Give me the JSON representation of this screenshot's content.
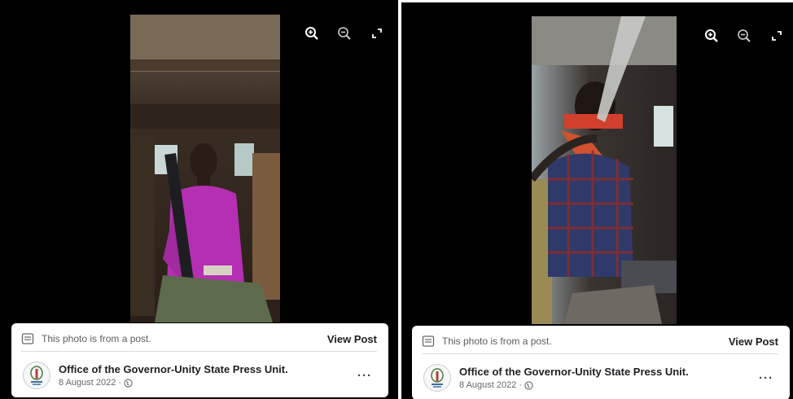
{
  "viewers": [
    {
      "post_note": "This photo is from a post.",
      "view_post_label": "View Post",
      "author_name": "Office of the Governor-Unity State Press Unit.",
      "date": "8 August 2022 ·",
      "more_label": "···",
      "controls": [
        "zoom-in-icon",
        "zoom-out-icon",
        "fullscreen-icon"
      ]
    },
    {
      "post_note": "This photo is from a post.",
      "view_post_label": "View Post",
      "author_name": "Office of the Governor-Unity State Press Unit.",
      "date": "8 August 2022 ·",
      "more_label": "···",
      "controls": [
        "zoom-in-icon",
        "zoom-out-icon",
        "fullscreen-icon"
      ]
    }
  ]
}
